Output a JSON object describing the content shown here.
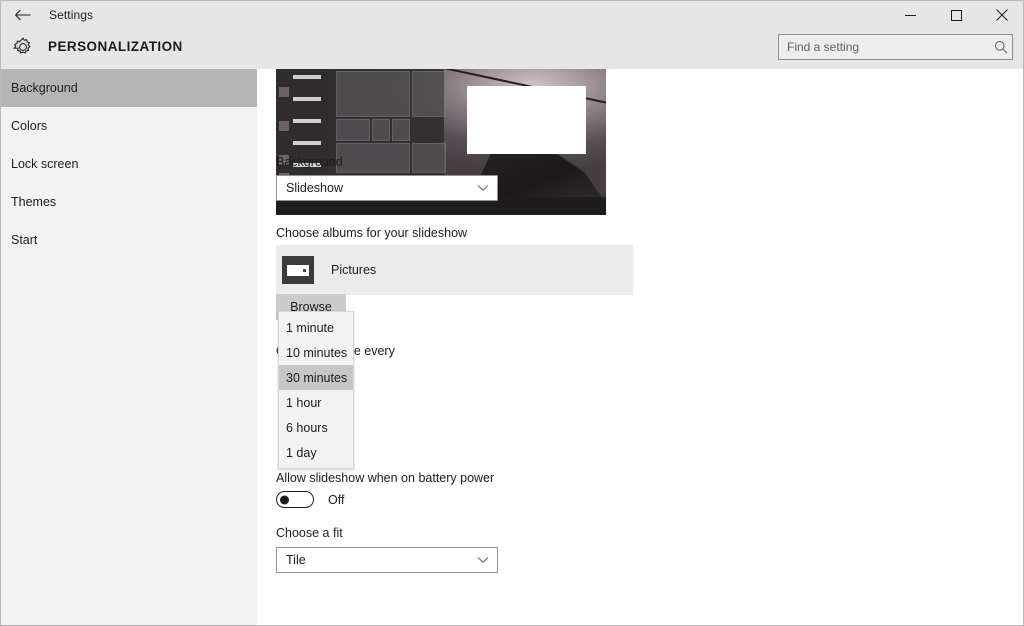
{
  "window": {
    "back_icon": "back-arrow-icon",
    "title": "Settings",
    "minimize_label": "minimize-icon",
    "maximize_label": "maximize-icon",
    "close_label": "close-icon"
  },
  "header": {
    "gear_icon": "gear-icon",
    "title": "PERSONALIZATION"
  },
  "search": {
    "placeholder": "Find a setting",
    "value": "",
    "icon": "search-icon"
  },
  "sidebar": {
    "items": [
      {
        "label": "Background",
        "selected": true
      },
      {
        "label": "Colors",
        "selected": false
      },
      {
        "label": "Lock screen",
        "selected": false
      },
      {
        "label": "Themes",
        "selected": false
      },
      {
        "label": "Start",
        "selected": false
      }
    ]
  },
  "main": {
    "preview_alt": "desktop-wallpaper-preview",
    "background_label": "Background",
    "background_value": "Slideshow",
    "albums_label": "Choose albums for your slideshow",
    "album_item": "Pictures",
    "album_icon": "folder-icon",
    "browse_label": "Browse",
    "change_every_label": "Change picture every",
    "battery_label": "Allow slideshow when on battery power",
    "battery_toggle_state": "Off",
    "fit_label": "Choose a fit",
    "fit_value": "Tile"
  },
  "dropdown": {
    "open": true,
    "selected": "30 minutes",
    "options": [
      "1 minute",
      "10 minutes",
      "30 minutes",
      "1 hour",
      "6 hours",
      "1 day"
    ]
  },
  "colors": {
    "chrome": "#e6e6e6",
    "sidebar": "#f2f2f2",
    "selection": "#b5b5b5",
    "dropdown_highlight": "#c6c6c6",
    "album_row": "#ebebeb",
    "text": "#1c1c1c"
  }
}
